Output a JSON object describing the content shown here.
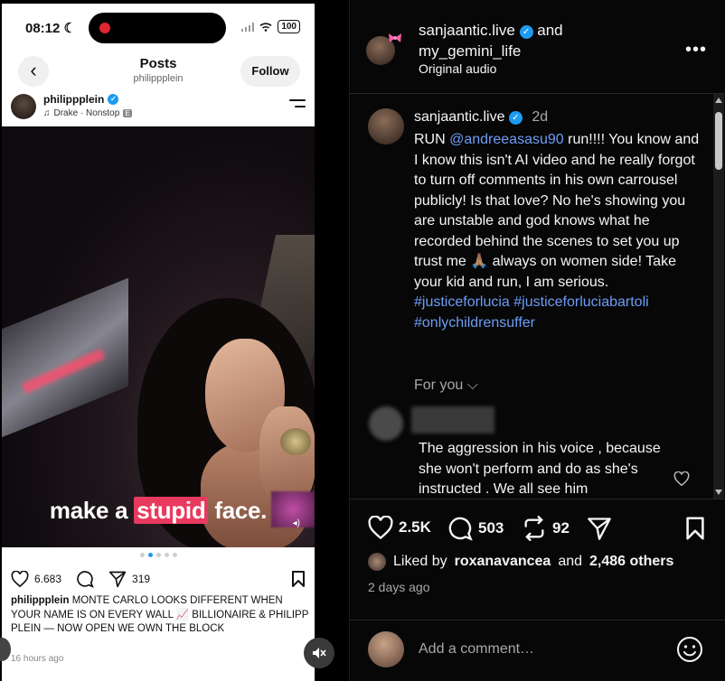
{
  "left_screenshot": {
    "status_bar": {
      "time": "08:12",
      "battery": "100"
    },
    "header": {
      "title": "Posts",
      "subtitle": "philippplein",
      "follow_label": "Follow"
    },
    "author": {
      "name": "philippplein",
      "music": "Drake · Nonstop",
      "explicit_badge": "E"
    },
    "video": {
      "caption_before": "make a ",
      "caption_highlight": "stupid",
      "caption_after": " face."
    },
    "actions": {
      "likes": "6.683",
      "shares": "319"
    },
    "caption": {
      "username": "philippplein",
      "text": " MONTE CARLO LOOKS DIFFERENT WHEN YOUR NAME IS ON EVERY WALL 📈 BILLIONAIRE & PHILIPP PLEIN — NOW OPEN WE OWN THE BLOCK"
    },
    "time_ago": "16 hours ago"
  },
  "post_header": {
    "username": "sanjaantic.live",
    "joiner": "and",
    "collaborator": "my_gemini_life",
    "audio": "Original audio"
  },
  "main_comment": {
    "username": "sanjaantic.live",
    "time": "2d",
    "text_parts": [
      {
        "t": "RUN ",
        "mention": false
      },
      {
        "t": "@andreeasasu90",
        "mention": true
      },
      {
        "t": " run!!!! You know and I know this isn't AI video and he really forgot to turn off comments in his own carrousel publicly! Is that love? No he's showing you are unstable and god knows what he recorded behind the scenes to set you up trust me 🙏🏽 always on women side! Take your kid and run, I am serious. ",
        "mention": false
      },
      {
        "t": "#justiceforlucia",
        "mention": true
      },
      {
        "t": " ",
        "mention": false
      },
      {
        "t": "#justiceforluciabartoli",
        "mention": true
      },
      {
        "t": " ",
        "mention": false
      },
      {
        "t": "#onlychildrensuffer",
        "mention": true
      }
    ]
  },
  "for_you_label": "For you",
  "reply": {
    "text": "The aggression in his voice , because she won't perform and do as she's instructed . We all see him"
  },
  "actions": {
    "likes": "2.5K",
    "comments": "503",
    "reposts": "92"
  },
  "liked_by": {
    "prefix": "Liked by",
    "user": "roxanavancea",
    "joiner": "and",
    "others": "2,486 others"
  },
  "time_ago": "2 days ago",
  "add_comment_placeholder": "Add a comment…"
}
